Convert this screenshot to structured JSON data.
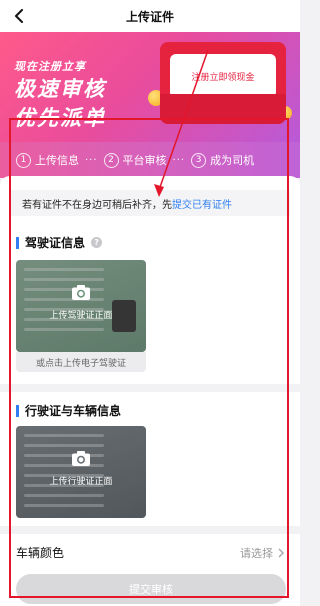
{
  "nav": {
    "title": "上传证件"
  },
  "banner": {
    "line1": "现在注册立享",
    "line2": "极速审核",
    "line3": "优先派单",
    "envelope_text": "注册立即领现金"
  },
  "steps": [
    {
      "num": "1",
      "label": "上传信息"
    },
    {
      "num": "2",
      "label": "平台审核"
    },
    {
      "num": "3",
      "label": "成为司机"
    }
  ],
  "tip": {
    "text": "若有证件不在身边可稍后补齐，先",
    "link": "提交已有证件"
  },
  "driver_license": {
    "title": "驾驶证信息",
    "upload_caption": "上传驾驶证正面",
    "electronic_link": "或点击上传电子驾驶证"
  },
  "vehicle_license": {
    "title": "行驶证与车辆信息",
    "upload_caption": "上传行驶证正面"
  },
  "vehicle_color": {
    "label": "车辆颜色",
    "placeholder": "请选择"
  },
  "submit": {
    "label": "提交审核"
  }
}
